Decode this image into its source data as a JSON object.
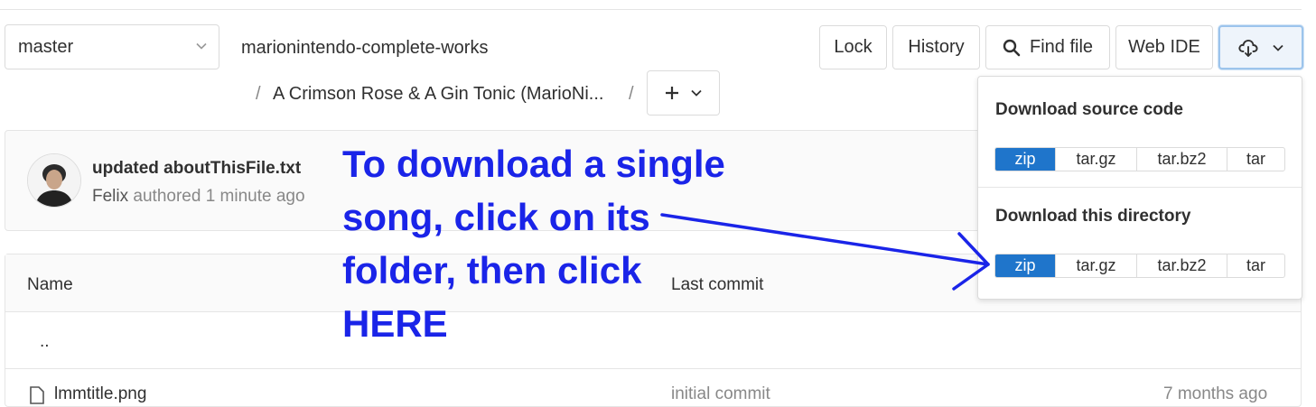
{
  "branch": {
    "selected": "master"
  },
  "breadcrumb": {
    "root": "marionintendo-complete-works",
    "separator": "/",
    "folder": "A Crimson Rose & A Gin Tonic (MarioNi..."
  },
  "toolbar": {
    "lock": "Lock",
    "history": "History",
    "find_file": "Find file",
    "web_ide": "Web IDE"
  },
  "commit": {
    "title": "updated aboutThisFile.txt",
    "author": "Felix",
    "meta": "authored 1 minute ago"
  },
  "table": {
    "headers": {
      "name": "Name",
      "last_commit": "Last commit"
    },
    "rows": [
      {
        "name": "..",
        "commit": "",
        "date": ""
      },
      {
        "name": "lmmtitle.png",
        "commit": "initial commit",
        "date": "7 months ago"
      }
    ]
  },
  "annotation": {
    "text_lines": [
      "To download a single",
      "song, click on its",
      "folder, then click",
      "HERE"
    ],
    "color": "#1a24e8"
  },
  "download_menu": {
    "source": {
      "title": "Download source code",
      "formats": [
        "zip",
        "tar.gz",
        "tar.bz2",
        "tar"
      ],
      "active": "zip"
    },
    "directory": {
      "title": "Download this directory",
      "formats": [
        "zip",
        "tar.gz",
        "tar.bz2",
        "tar"
      ],
      "active": "zip"
    }
  },
  "colors": {
    "accent": "#1f75cb",
    "annotation": "#1a24e8"
  }
}
